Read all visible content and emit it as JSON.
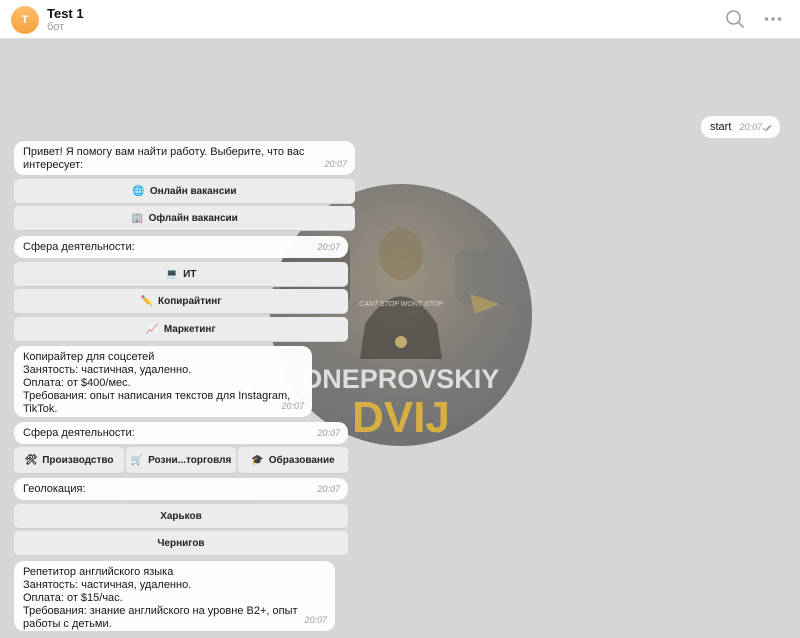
{
  "header": {
    "avatar_letter": "T",
    "title": "Test 1",
    "subtitle": "бот",
    "search_icon": "search-icon",
    "more_icon": "more-icon"
  },
  "watermark": {
    "line1": "DNEPROVSKIY",
    "line2": "DVIJ",
    "cap_text": "CANT STOP WONT STOP"
  },
  "messages": {
    "start": {
      "text": "start",
      "time": "20:07"
    },
    "greeting": {
      "text": "Привет! Я помогу вам найти работу. Выберите, что вас интересует:",
      "time": "20:07"
    },
    "sphere1": {
      "text": "Сфера деятельности:",
      "time": "20:07"
    },
    "vacancy1": {
      "text": "Копирайтер для соцсетей\nЗанятость: частичная, удаленно.\nОплата: от $400/мес.\nТребования: опыт написания текстов для Instagram, TikTok.",
      "time": "20:07"
    },
    "sphere2": {
      "text": "Сфера деятельности:",
      "time": "20:07"
    },
    "geo": {
      "text": "Геолокация:",
      "time": "20:07"
    },
    "vacancy2": {
      "text": "Репетитор английского языка\nЗанятость: частичная, удаленно.\nОплата: от $15/час.\nТребования: знание английского на уровне B2+, опыт работы с детьми.",
      "time": "20:07"
    }
  },
  "buttons": {
    "online": {
      "icon": "🌐",
      "label": "Онлайн вакансии"
    },
    "offline": {
      "icon": "🏢",
      "label": "Офлайн вакансии"
    },
    "it": {
      "icon": "💻",
      "label": "ИТ"
    },
    "copy": {
      "icon": "✏️",
      "label": "Копирайтинг"
    },
    "marketing": {
      "icon": "📈",
      "label": "Маркетинг"
    },
    "production": {
      "icon": "🛠",
      "label": "Производство"
    },
    "retail": {
      "icon": "🛒",
      "label": "Розни...торговля"
    },
    "education": {
      "icon": "🎓",
      "label": "Образование"
    },
    "kharkiv": {
      "label": "Харьков"
    },
    "chernihiv": {
      "label": "Чернигов"
    }
  }
}
